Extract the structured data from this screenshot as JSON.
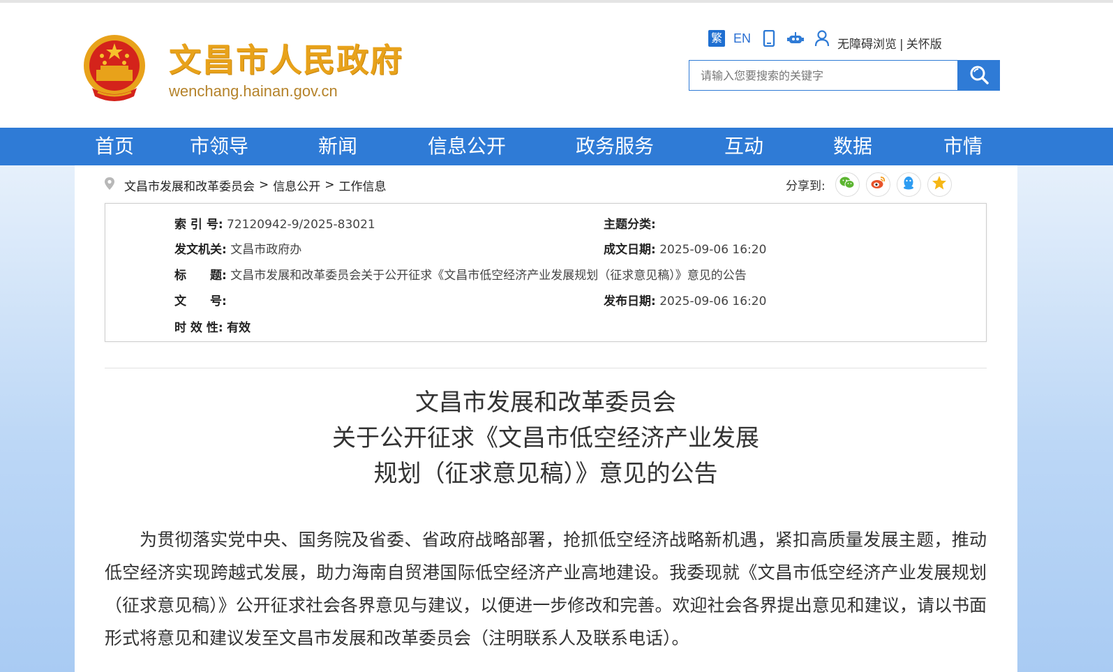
{
  "header": {
    "site_title": "文昌市人民政府",
    "site_domain": "wenchang.hainan.gov.cn",
    "tools": {
      "traditional_label": "繁",
      "english_label": "EN",
      "accessibility_label": "无障碍浏览",
      "separator": "|",
      "elder_label": "关怀版"
    },
    "search": {
      "placeholder": "请输入您要搜索的关键字"
    }
  },
  "nav": {
    "items": [
      "首页",
      "市领导",
      "新闻",
      "信息公开",
      "政务服务",
      "互动",
      "数据",
      "市情"
    ]
  },
  "breadcrumb": {
    "items": [
      "文昌市发展和改革委员会",
      "信息公开",
      "工作信息"
    ],
    "separator": ">"
  },
  "share": {
    "label": "分享到:"
  },
  "meta": {
    "index_label": "索 引 号:",
    "index_value": "72120942-9/2025-83021",
    "topic_label": "主题分类:",
    "topic_value": "",
    "issuer_label": "发文机关:",
    "issuer_value": "文昌市政府办",
    "created_label": "成文日期:",
    "created_value": "2025-09-06 16:20",
    "title_label": "标　　题:",
    "title_value": "文昌市发展和改革委员会关于公开征求《文昌市低空经济产业发展规划（征求意见稿）》意见的公告",
    "docno_label": "文　　号:",
    "docno_value": "",
    "published_label": "发布日期:",
    "published_value": "2025-09-06 16:20",
    "validity_label": "时 效 性:",
    "validity_value": "有效"
  },
  "article": {
    "title_line1": "文昌市发展和改革委员会",
    "title_line2": "关于公开征求《文昌市低空经济产业发展",
    "title_line3": "规划（征求意见稿）》意见的公告",
    "paragraph1": "为贯彻落实党中央、国务院及省委、省政府战略部署，抢抓低空经济战略新机遇，紧扣高质量发展主题，推动低空经济实现跨越式发展，助力海南自贸港国际低空经济产业高地建设。我委现就《文昌市低空经济产业发展规划（征求意见稿）》公开征求社会各界意见与建议，以便进一步修改和完善。欢迎社会各界提出意见和建议，请以书面形式将意见和建议发至文昌市发展和改革委员会（注明联系人及联系电话）。"
  },
  "colors": {
    "brand_blue": "#2f7bd6",
    "title_gold": "#e8a21a",
    "wechat_green": "#5cb531",
    "weibo_orange": "#e8532b",
    "qq_blue": "#2d9cf2",
    "qzone_yellow": "#f6b716"
  }
}
